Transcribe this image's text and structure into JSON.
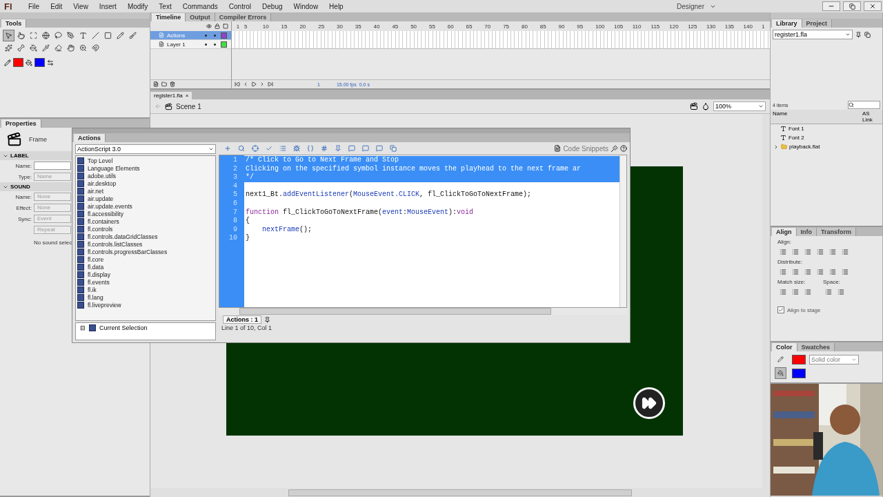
{
  "menu_bar": {
    "logo": "Fl",
    "items": [
      "File",
      "Edit",
      "View",
      "Insert",
      "Modify",
      "Text",
      "Commands",
      "Control",
      "Debug",
      "Window",
      "Help"
    ],
    "workspace": "Designer"
  },
  "tools_panel": {
    "title": "Tools",
    "tools": [
      {
        "selected": true
      },
      {
        "selected": false
      },
      {
        "selected": false
      },
      {
        "selected": false
      },
      {
        "selected": false
      },
      {
        "selected": false
      },
      {
        "selected": false
      },
      {
        "selected": false
      },
      {
        "selected": false
      },
      {
        "selected": false
      },
      {
        "selected": false
      },
      {
        "selected": false
      },
      {
        "selected": false
      },
      {
        "selected": false
      },
      {
        "selected": false
      },
      {
        "selected": false
      },
      {
        "selected": false
      },
      {
        "selected": false
      },
      {
        "selected": false
      }
    ],
    "stroke": {
      "color": "#ff0000"
    },
    "fill": {
      "color": "#0000ff"
    }
  },
  "properties_panel": {
    "title": "Properties",
    "type_label": "Frame",
    "sections": [
      {
        "title": "LABEL",
        "expanded": true,
        "fields": [
          {
            "label": "Name:",
            "kind": "input",
            "disabled": false
          },
          {
            "label": "Type:",
            "value": "Name",
            "kind": "select",
            "disabled": true
          }
        ]
      },
      {
        "title": "SOUND",
        "expanded": true,
        "fields": [
          {
            "label": "Name:",
            "value": "None",
            "kind": "select",
            "disabled": true
          },
          {
            "label": "Effect:",
            "value": "None",
            "kind": "select",
            "disabled": true
          },
          {
            "label": "Sync:",
            "value": "Event",
            "kind": "select",
            "disabled": true
          },
          {
            "value": "Repeat",
            "kind": "select",
            "disabled": true
          }
        ],
        "note": "No sound selec"
      }
    ]
  },
  "timeline": {
    "tabs": [
      {
        "label": "Timeline",
        "selected": true
      },
      {
        "label": "Output",
        "selected": false
      },
      {
        "label": "Compiler Errors",
        "selected": false
      }
    ],
    "frame_numbers": [
      "1",
      "5",
      "10",
      "15",
      "20",
      "25",
      "30",
      "35",
      "40",
      "45",
      "50",
      "55",
      "60",
      "65",
      "70",
      "75",
      "80",
      "85",
      "90",
      "95",
      "100",
      "105",
      "110",
      "115",
      "120",
      "125",
      "130",
      "135",
      "140",
      "1"
    ],
    "layers": [
      {
        "name": "Actions",
        "selected": true,
        "color": "#8e44c8"
      },
      {
        "name": "Layer 1",
        "selected": false,
        "color": "#44dd44"
      }
    ],
    "status": {
      "frame": "1",
      "fps": "15.00 fps",
      "time": "0.0 s"
    }
  },
  "document": {
    "tab": "register1.fla",
    "close": "×",
    "scene": "Scene 1",
    "zoom": "100%"
  },
  "actions_panel": {
    "title": "Actions",
    "language": "ActionScript 3.0",
    "packages": [
      "Top Level",
      "Language Elements",
      "adobe.utils",
      "air.desktop",
      "air.net",
      "air.update",
      "air.update.events",
      "fl.accessibility",
      "fl.containers",
      "fl.controls",
      "fl.controls.dataGridClasses",
      "fl.controls.listClasses",
      "fl.controls.progressBarClasses",
      "fl.core",
      "fl.data",
      "fl.display",
      "fl.events",
      "fl.ik",
      "fl.lang",
      "fl.livepreview"
    ],
    "current_selection_toggle": "⊟",
    "current_selection": "Current Selection",
    "code_snippets": "Code Snippets",
    "lines": [
      {
        "number": "1",
        "selected": true,
        "segments": [
          {
            "text": "/* Click to Go to Next Frame and Stop",
            "kind": "plain"
          }
        ]
      },
      {
        "number": "2",
        "selected": true,
        "segments": [
          {
            "text": "Clicking on the specified symbol instance moves the playhead to the next frame ar",
            "kind": "plain"
          }
        ]
      },
      {
        "number": "3",
        "selected": true,
        "segments": [
          {
            "text": "*/",
            "kind": "plain"
          }
        ]
      },
      {
        "number": "4",
        "selected": false
      },
      {
        "number": "5",
        "selected": false,
        "segments": [
          {
            "text": "next1_Bt.",
            "kind": "plain"
          },
          {
            "text": "addEventListener",
            "kind": "method"
          },
          {
            "text": "(",
            "kind": "plain"
          },
          {
            "text": "MouseEvent.CLICK",
            "kind": "type"
          },
          {
            "text": ", fl_ClickToGoToNextFrame);",
            "kind": "plain"
          }
        ]
      },
      {
        "number": "6",
        "selected": false
      },
      {
        "number": "7",
        "selected": false,
        "segments": [
          {
            "text": "function",
            "kind": "keyword"
          },
          {
            "text": " fl_ClickToGoToNextFrame(",
            "kind": "plain"
          },
          {
            "text": "event",
            "kind": "method"
          },
          {
            "text": ":",
            "kind": "plain"
          },
          {
            "text": "MouseEvent",
            "kind": "type"
          },
          {
            "text": "):",
            "kind": "plain"
          },
          {
            "text": "void",
            "kind": "keyword"
          }
        ]
      },
      {
        "number": "8",
        "selected": false,
        "segments": [
          {
            "text": "{",
            "kind": "plain"
          }
        ]
      },
      {
        "number": "9",
        "selected": false,
        "segments": [
          {
            "text": "    nextFrame",
            "kind": "method"
          },
          {
            "text": "();",
            "kind": "plain"
          }
        ]
      },
      {
        "number": "10",
        "selected": false,
        "segments": [
          {
            "text": "}",
            "kind": "plain"
          }
        ]
      }
    ],
    "script_tab": "Actions : 1",
    "status": "Line 1 of 10, Col 1"
  },
  "library_panel": {
    "tabs": [
      {
        "label": "Library",
        "selected": true
      },
      {
        "label": "Project",
        "selected": false
      }
    ],
    "file": "register1.fla",
    "count": "4 items",
    "columns": [
      "Name",
      "AS Link"
    ],
    "items": [
      {
        "name": "Font 1",
        "kind": "font"
      },
      {
        "name": "Font 2",
        "kind": "font"
      },
      {
        "name": "playback.flat",
        "kind": "folder",
        "expanded": false
      }
    ]
  },
  "align_panel": {
    "tabs": [
      {
        "label": "Align",
        "selected": true
      },
      {
        "label": "Info",
        "selected": false
      },
      {
        "label": "Transform",
        "selected": false
      }
    ],
    "groups": [
      "Align:",
      "Distribute:",
      "Match size:",
      "Space:"
    ],
    "align_to_stage": {
      "label": "Align to stage",
      "checked": true
    }
  },
  "color_panel": {
    "tabs": [
      {
        "label": "Color",
        "selected": true
      },
      {
        "label": "Swatches",
        "selected": false
      }
    ],
    "fill_type": "Solid color",
    "stroke": {
      "color": "#ff0000"
    },
    "fill": {
      "color": "#0000ff"
    }
  }
}
